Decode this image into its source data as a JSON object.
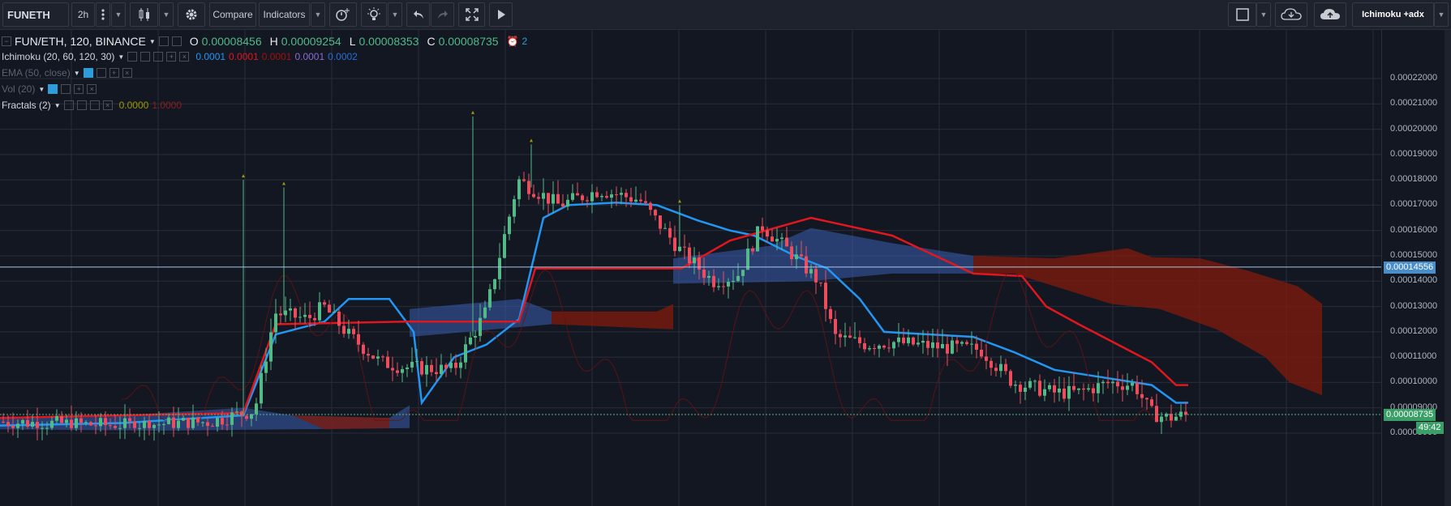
{
  "toolbar": {
    "symbol": "FUNETH",
    "interval": "2h",
    "compare_label": "Compare",
    "indicators_label": "Indicators",
    "layout_name": "Ichimoku +adx"
  },
  "legend": {
    "title": "FUN/ETH, 120, BINANCE",
    "o_label": "O",
    "o_value": "0.00008456",
    "h_label": "H",
    "h_value": "0.00009254",
    "l_label": "L",
    "l_value": "0.00008353",
    "c_label": "C",
    "c_value": "0.00008735",
    "alerts_count": "2",
    "indicators": [
      {
        "name": "Ichimoku (20, 60, 120, 30)",
        "values": [
          "0.0001",
          "0.0001",
          "0.0001",
          "0.0001",
          "0.0002"
        ],
        "colors": [
          "#2196f3",
          "#e0171f",
          "#a01010",
          "#8a6bd1",
          "#2a6fd6"
        ]
      },
      {
        "name": "EMA (50, close)",
        "values": [],
        "colors": []
      },
      {
        "name": "Vol (20)",
        "values": [],
        "colors": []
      },
      {
        "name": "Fractals (2)",
        "values": [
          "0.0000",
          "1.0000"
        ],
        "colors": [
          "#9a9a00",
          "#8a1f1f"
        ]
      }
    ]
  },
  "price_axis": {
    "ticks": [
      "0.00022000",
      "0.00021000",
      "0.00020000",
      "0.00019000",
      "0.00018000",
      "0.00017000",
      "0.00016000",
      "0.00015000",
      "0.00014000",
      "0.00013000",
      "0.00012000",
      "0.00011000",
      "0.00010000",
      "0.00009000",
      "0.00008000"
    ],
    "crosshair_price": "0.00014556",
    "last_price": "0.00008735",
    "countdown": "49:42"
  },
  "colors": {
    "background": "#131722",
    "grid": "#2a2e39",
    "up_candle": "#53b987",
    "down_candle": "#eb4d5c",
    "conversion_line": "#2196f3",
    "base_line": "#e0171f",
    "bull_cloud": "#3a5fb0",
    "bear_cloud": "#7a1a0e"
  }
}
